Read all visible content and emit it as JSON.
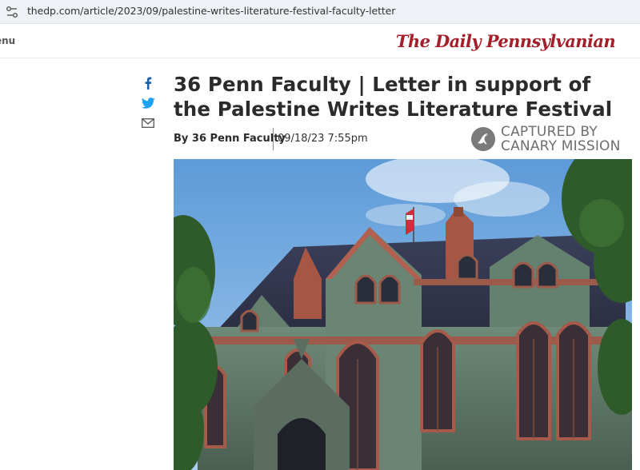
{
  "browser": {
    "url": "thedp.com/article/2023/09/palestine-writes-literature-festival-faculty-letter",
    "site_info_icon": "tune-icon"
  },
  "header": {
    "menu_label": "enu",
    "masthead": "The Daily Pennsylvanian"
  },
  "share": {
    "icons": [
      "facebook-icon",
      "twitter-icon",
      "mail-icon"
    ],
    "facebook_color": "#1d5fa8",
    "twitter_color": "#1da1f2",
    "mail_color": "#555555"
  },
  "article": {
    "headline": "36 Penn Faculty | Letter in support of the Palestine Writes Literature Festival",
    "by_prefix": "By ",
    "author": "36 Penn Faculty",
    "date": "09/18/23 7:55pm"
  },
  "watermark": {
    "line1": "CAPTURED BY",
    "line2": "CANARY MISSION"
  },
  "colors": {
    "masthead_red": "#a3202a",
    "sky_blue": "#7fb2e3"
  }
}
